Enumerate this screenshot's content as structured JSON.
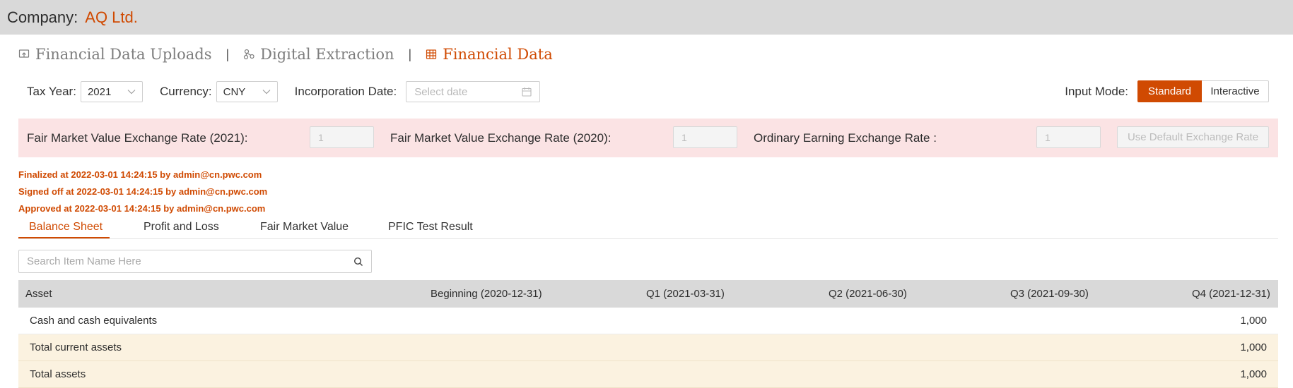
{
  "company": {
    "label": "Company:",
    "name": "AQ Ltd."
  },
  "nav": {
    "items": [
      {
        "label": "Financial Data Uploads",
        "icon": "upload-icon"
      },
      {
        "label": "Digital Extraction",
        "icon": "extraction-icon"
      },
      {
        "label": "Financial Data",
        "icon": "table-icon",
        "active": true
      }
    ],
    "separator": "|"
  },
  "filters": {
    "tax_year_label": "Tax Year:",
    "tax_year_value": "2021",
    "currency_label": "Currency:",
    "currency_value": "CNY",
    "incorporation_label": "Incorporation Date:",
    "incorporation_placeholder": "Select date"
  },
  "input_mode": {
    "label": "Input Mode:",
    "options": [
      "Standard",
      "Interactive"
    ],
    "selected": "Standard"
  },
  "rates": {
    "fmv_2021_label": "Fair Market Value Exchange Rate (2021):",
    "fmv_2021_value": "1",
    "fmv_2020_label": "Fair Market Value Exchange Rate (2020):",
    "fmv_2020_value": "1",
    "ordinary_label": "Ordinary Earning Exchange Rate :",
    "ordinary_value": "1",
    "default_button": "Use Default Exchange Rate"
  },
  "status_lines": [
    "Finalized at 2022-03-01 14:24:15 by admin@cn.pwc.com",
    "Signed off at 2022-03-01 14:24:15 by admin@cn.pwc.com",
    "Approved at 2022-03-01 14:24:15 by admin@cn.pwc.com"
  ],
  "tabs": [
    "Balance Sheet",
    "Profit and Loss",
    "Fair Market Value",
    "PFIC Test Result"
  ],
  "active_tab": "Balance Sheet",
  "search": {
    "placeholder": "Search Item Name Here"
  },
  "table": {
    "columns": [
      "Asset",
      "Beginning (2020-12-31)",
      "Q1 (2021-03-31)",
      "Q2 (2021-06-30)",
      "Q3 (2021-09-30)",
      "Q4 (2021-12-31)"
    ],
    "rows": [
      {
        "name": "Cash and cash equivalents",
        "q4": "1,000",
        "total": false
      },
      {
        "name": "Total current assets",
        "q4": "1,000",
        "total": true
      },
      {
        "name": "Total assets",
        "q4": "1,000",
        "total": true
      }
    ]
  },
  "colors": {
    "accent": "#d04a02",
    "rate_band": "#fbe3e4",
    "total_row": "#fbf2e0",
    "header": "#d9d9d9"
  }
}
